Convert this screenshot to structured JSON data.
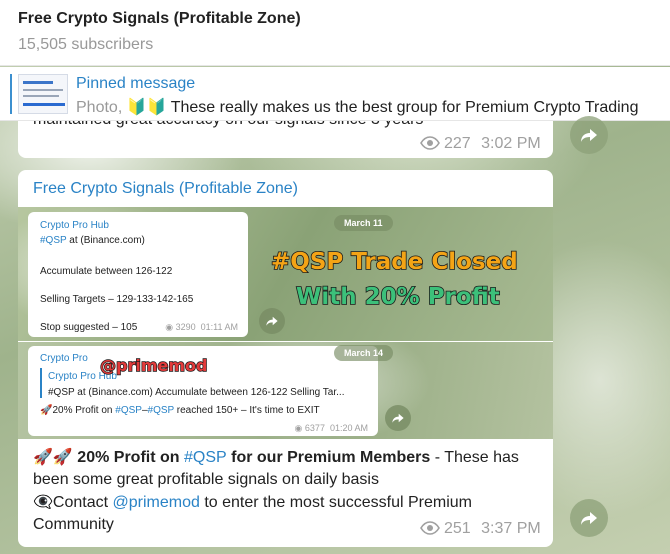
{
  "header": {
    "title": "Free Crypto Signals (Profitable Zone)",
    "subscribers": "15,505 subscribers"
  },
  "pinned": {
    "label": "Pinned message",
    "type": "Photo,",
    "emoji": "🔰🔰",
    "text": "These really makes us the best group for Premium Crypto Trading"
  },
  "message1": {
    "partial_text": "maintained great accuracy on our signals since 3 years",
    "views": "227",
    "time": "3:02 PM"
  },
  "message2": {
    "author": "Free Crypto Signals (Profitable Zone)",
    "photo1": {
      "date": "March 11",
      "source": "Crypto Pro Hub",
      "tag": "#QSP",
      "exchange": "at (Binance.com)",
      "line_accumulate": "Accumulate between 126-122",
      "line_targets": "Selling Targets – 129-133-142-165",
      "line_stop": "Stop suggested – 105",
      "views": "3290",
      "time": "01:11 AM",
      "headline_1": "#QSP Trade Closed",
      "headline_2": "With 20% Profit"
    },
    "photo2": {
      "date": "March 14",
      "source": "Crypto Pro",
      "watermark": "@primemod",
      "quote_source": "Crypto Pro Hub",
      "quote_text": "#QSP at (Binance.com)   Accumulate between 126-122  Selling Tar...",
      "profit_emoji": "🚀",
      "profit_prefix": "20% Profit on ",
      "profit_tag": "#QSP",
      "profit_dash": "–",
      "profit_tag2": "#QSP",
      "profit_suffix": " reached 150+ – It's time to EXIT",
      "views": "6377",
      "time": "01:20 AM"
    },
    "caption": {
      "emoji_start": "🚀🚀",
      "bold_1": "20% Profit on ",
      "tag": "#QSP",
      "bold_2": " for our Premium Members",
      "rest_1": " - These has been some great profitable signals on daily basis",
      "emoji_eye": "👁‍🗨",
      "contact_1": "Contact ",
      "handle": "@primemod",
      "contact_2": " to enter the most successful Premium Community"
    },
    "views": "251",
    "time": "3:37 PM"
  },
  "icons": {
    "share": "share-icon",
    "views": "eye-icon"
  },
  "colors": {
    "link": "#2a83c6",
    "headline_orange": "#f4a416",
    "headline_green": "#3cc07a"
  }
}
